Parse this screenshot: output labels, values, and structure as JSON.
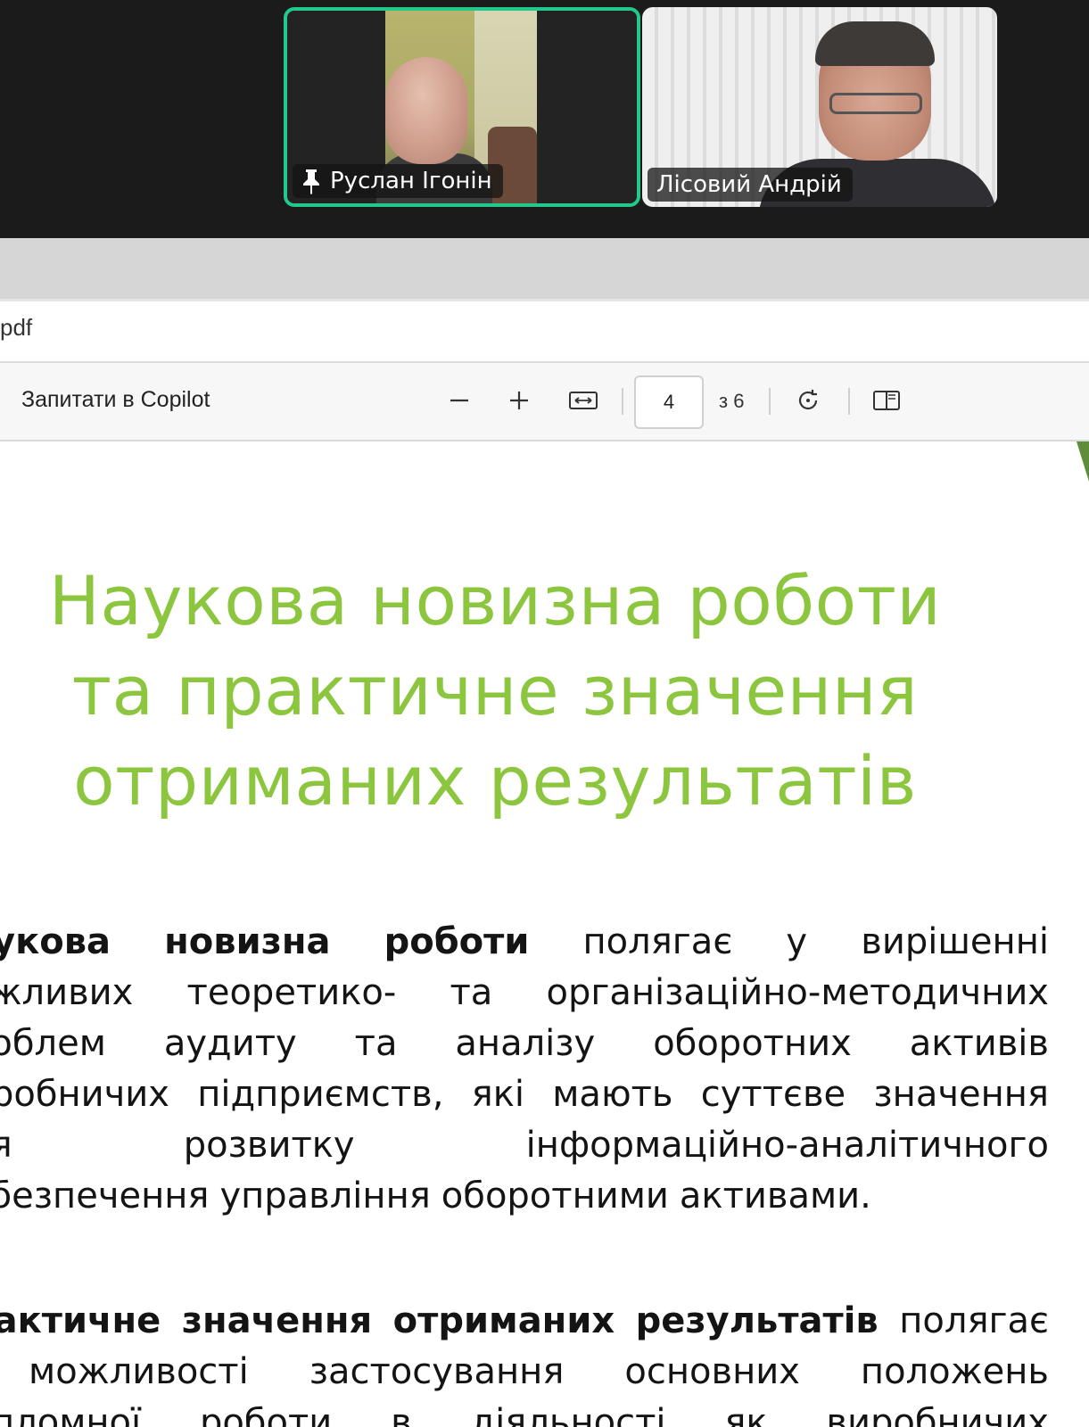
{
  "participants": [
    {
      "name": "Руслан Ігонін",
      "pinned": true,
      "active_speaker": true
    },
    {
      "name": "Лісовий Андрій",
      "pinned": false,
      "active_speaker": false
    }
  ],
  "browser": {
    "address_fragment": "pdf"
  },
  "pdf_toolbar": {
    "copilot_label": "Запитати в Copilot",
    "current_page": "4",
    "page_total_label": "з 6",
    "icons": [
      "zoom-out-icon",
      "zoom-in-icon",
      "fit-width-icon",
      "rotate-icon",
      "page-view-icon"
    ]
  },
  "slide": {
    "title_lines": [
      "Наукова новизна роботи",
      "та практичне значення",
      "отриманих результатів"
    ],
    "paragraph1": {
      "lines": [
        [
          "аукова",
          "новизна",
          "роботи",
          "полягає",
          "у",
          "вирішенні"
        ],
        [
          "ажливих",
          "теоретико-",
          "та",
          "організаційно-методичних"
        ],
        [
          "роблем",
          "аудиту",
          "та",
          "аналізу",
          "оборотних",
          "активів"
        ],
        [
          "иробничих",
          "підприємств,",
          "які",
          "мають",
          "суттєве",
          "значення"
        ],
        [
          "ля",
          "розвитку",
          "інформаційно-аналітичного"
        ],
        [
          "абезпечення",
          "управління",
          "оборотними",
          "активами."
        ]
      ]
    },
    "paragraph2": {
      "lines": [
        [
          "рактичне",
          "значення",
          "отриманих",
          "результатів",
          "полягає"
        ],
        [
          "",
          "можливості",
          "застосування",
          "основних",
          "положень"
        ],
        [
          "ипломної",
          "роботи",
          "в",
          "діяльності",
          "як",
          "виробничих"
        ]
      ]
    }
  },
  "colors": {
    "active_speaker_border": "#22c98b",
    "title_green": "#8cc63f"
  }
}
